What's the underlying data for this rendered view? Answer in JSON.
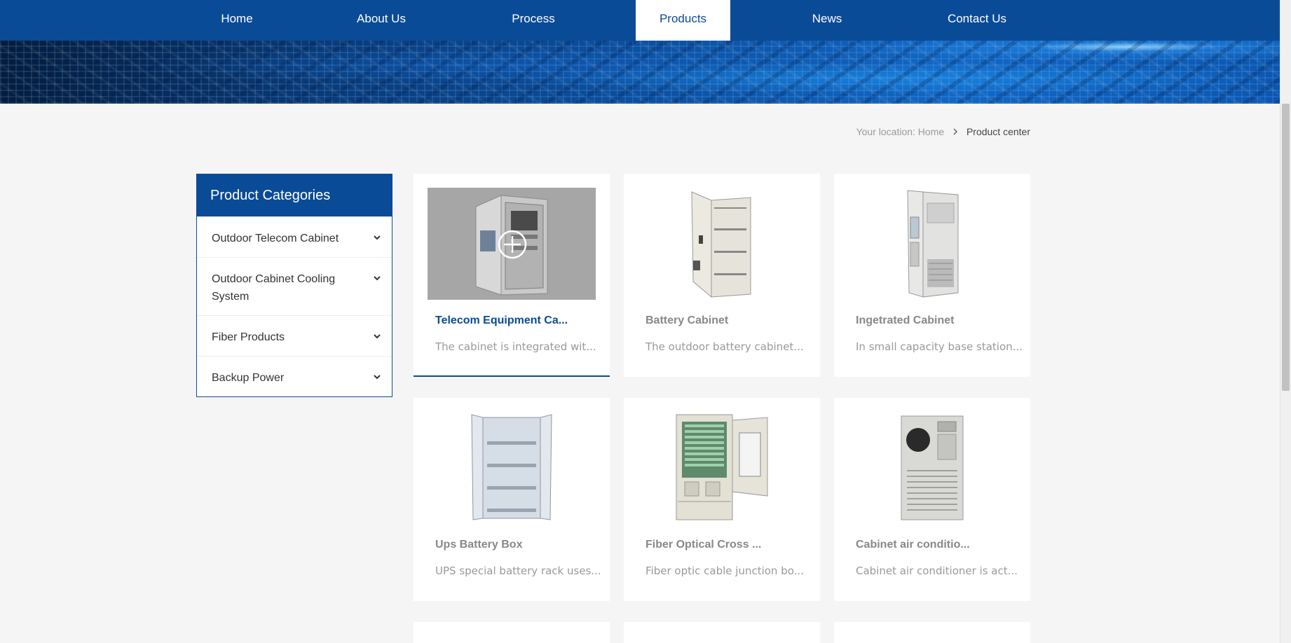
{
  "nav": {
    "items": [
      {
        "label": "Home",
        "active": false
      },
      {
        "label": "About Us",
        "active": false
      },
      {
        "label": "Process",
        "active": false
      },
      {
        "label": "Products",
        "active": true
      },
      {
        "label": "News",
        "active": false
      },
      {
        "label": "Contact Us",
        "active": false
      }
    ]
  },
  "breadcrumb": {
    "prefix": "Your location:",
    "home": "Home",
    "current": "Product center"
  },
  "sidebar": {
    "title": "Product Categories",
    "items": [
      {
        "label": "Outdoor Telecom Cabinet"
      },
      {
        "label": "Outdoor Cabinet Cooling System"
      },
      {
        "label": "Fiber Products"
      },
      {
        "label": "Backup Power"
      }
    ]
  },
  "products": [
    {
      "title": "Telecom Equipment Ca...",
      "desc": "The cabinet is integrated wit...",
      "image_icon": "telecom-cabinet-image"
    },
    {
      "title": "Battery Cabinet",
      "desc": "The outdoor battery cabinet...",
      "image_icon": "battery-cabinet-image"
    },
    {
      "title": "Ingetrated Cabinet",
      "desc": "In small capacity base station...",
      "image_icon": "integrated-cabinet-image"
    },
    {
      "title": "Ups Battery Box",
      "desc": "UPS special battery rack uses...",
      "image_icon": "ups-battery-box-image"
    },
    {
      "title": "Fiber Optical Cross ...",
      "desc": "Fiber optic cable junction bo...",
      "image_icon": "fiber-cross-cabinet-image"
    },
    {
      "title": "Cabinet air conditio...",
      "desc": "Cabinet air conditioner is act...",
      "image_icon": "cabinet-air-conditioner-image"
    }
  ],
  "colors": {
    "brand": "#0a4b97",
    "background": "#f5f5f5",
    "card": "#ffffff",
    "muted_text": "#999999"
  }
}
